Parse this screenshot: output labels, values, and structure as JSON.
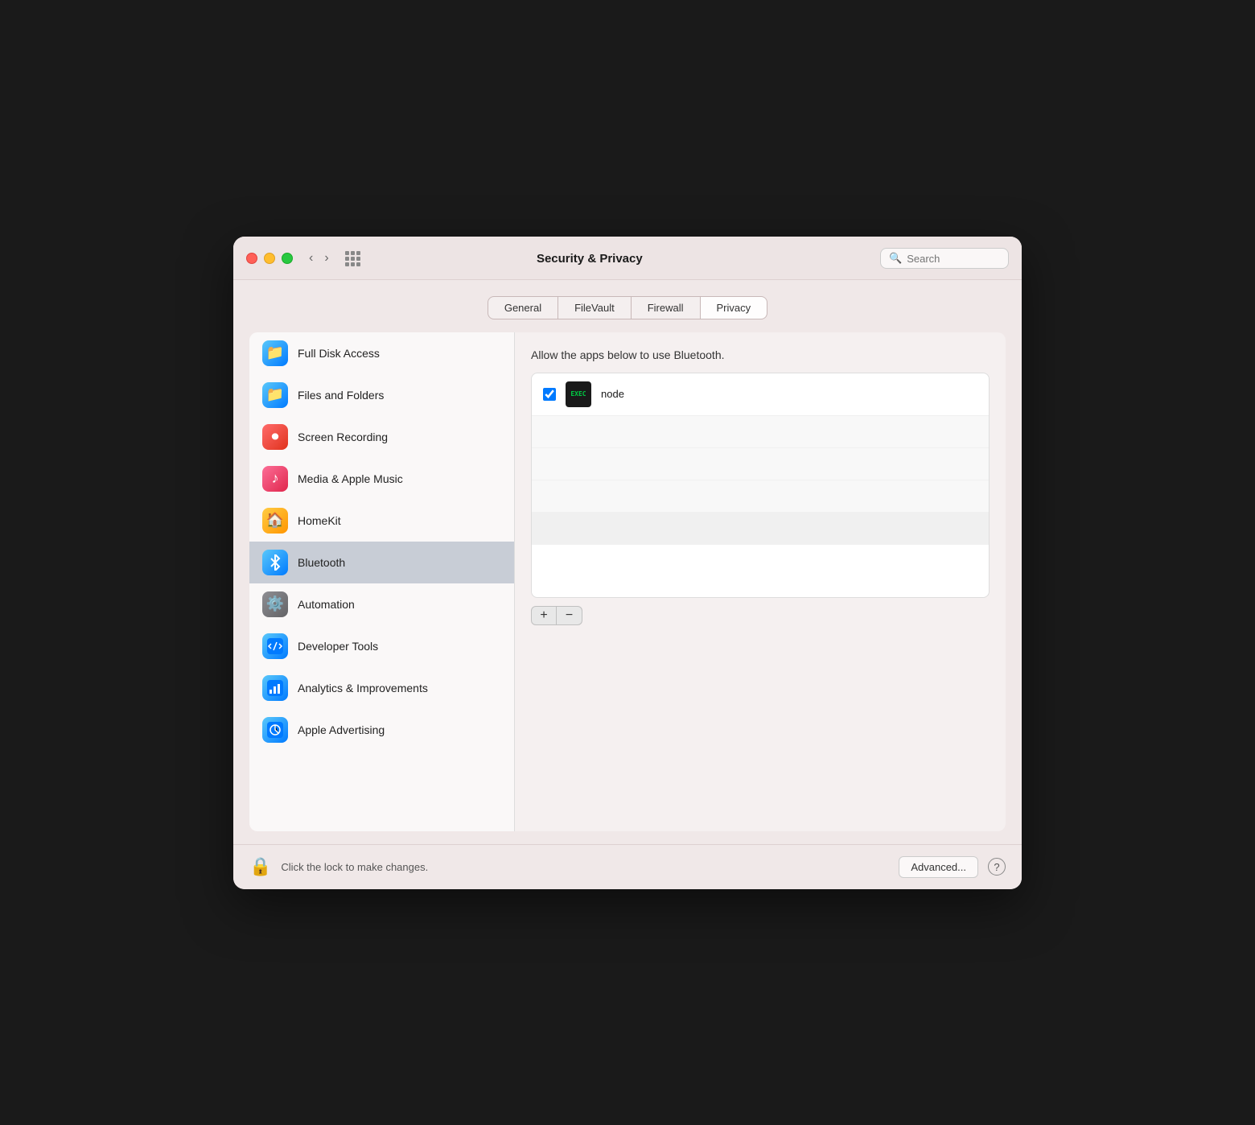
{
  "window": {
    "title": "Security & Privacy"
  },
  "search": {
    "placeholder": "Search"
  },
  "tabs": [
    {
      "id": "general",
      "label": "General",
      "active": false
    },
    {
      "id": "filevault",
      "label": "FileVault",
      "active": false
    },
    {
      "id": "firewall",
      "label": "Firewall",
      "active": false
    },
    {
      "id": "privacy",
      "label": "Privacy",
      "active": true
    }
  ],
  "sidebar": {
    "items": [
      {
        "id": "full-disk-access",
        "label": "Full Disk Access",
        "icon": "folder"
      },
      {
        "id": "files-and-folders",
        "label": "Files and Folders",
        "icon": "folder"
      },
      {
        "id": "screen-recording",
        "label": "Screen Recording",
        "icon": "screen-record"
      },
      {
        "id": "media-apple-music",
        "label": "Media & Apple Music",
        "icon": "music"
      },
      {
        "id": "homekit",
        "label": "HomeKit",
        "icon": "homekit"
      },
      {
        "id": "bluetooth",
        "label": "Bluetooth",
        "icon": "bluetooth",
        "active": true
      },
      {
        "id": "automation",
        "label": "Automation",
        "icon": "automation"
      },
      {
        "id": "developer-tools",
        "label": "Developer Tools",
        "icon": "devtools"
      },
      {
        "id": "analytics",
        "label": "Analytics & Improvements",
        "icon": "analytics"
      },
      {
        "id": "apple-advertising",
        "label": "Apple Advertising",
        "icon": "advertising"
      }
    ]
  },
  "panel": {
    "description": "Allow the apps below to use Bluetooth.",
    "apps": [
      {
        "name": "node",
        "checked": true
      }
    ],
    "add_label": "+",
    "remove_label": "−"
  },
  "bottom": {
    "lock_text": "Click the lock to make changes.",
    "advanced_label": "Advanced...",
    "help_label": "?"
  }
}
